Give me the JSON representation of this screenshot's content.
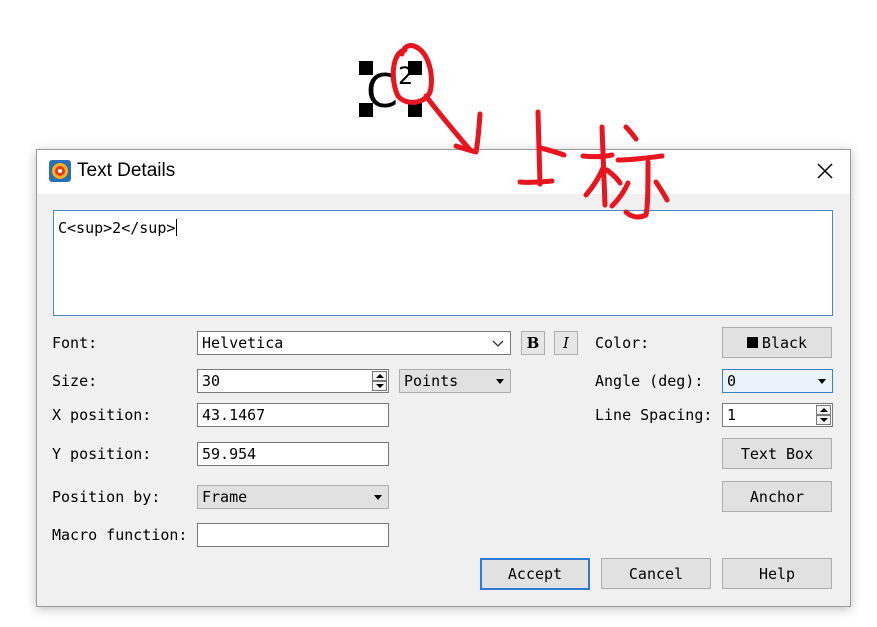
{
  "canvas": {
    "main_text": "C",
    "superscript": "2"
  },
  "dialog": {
    "title": "Text Details",
    "text_content": "C<sup>2</sup>",
    "font": {
      "label": "Font:",
      "value": "Helvetica",
      "bold_label": "B",
      "italic_label": "I"
    },
    "size": {
      "label": "Size:",
      "value": "30",
      "unit": "Points"
    },
    "x_position": {
      "label": "X position:",
      "value": "43.1467"
    },
    "y_position": {
      "label": "Y position:",
      "value": "59.954"
    },
    "position_by": {
      "label": "Position by:",
      "value": "Frame"
    },
    "macro_function": {
      "label": "Macro function:",
      "value": ""
    },
    "color": {
      "label": "Color:",
      "value": "Black",
      "swatch": "#000000"
    },
    "angle": {
      "label": "Angle (deg):",
      "value": "0"
    },
    "line_spacing": {
      "label": "Line Spacing:",
      "value": "1"
    },
    "buttons": {
      "text_box": "Text Box",
      "anchor": "Anchor",
      "accept": "Accept",
      "cancel": "Cancel",
      "help": "Help"
    }
  },
  "annotation": {
    "handwritten_text": "上标",
    "color": "#e8141e"
  }
}
